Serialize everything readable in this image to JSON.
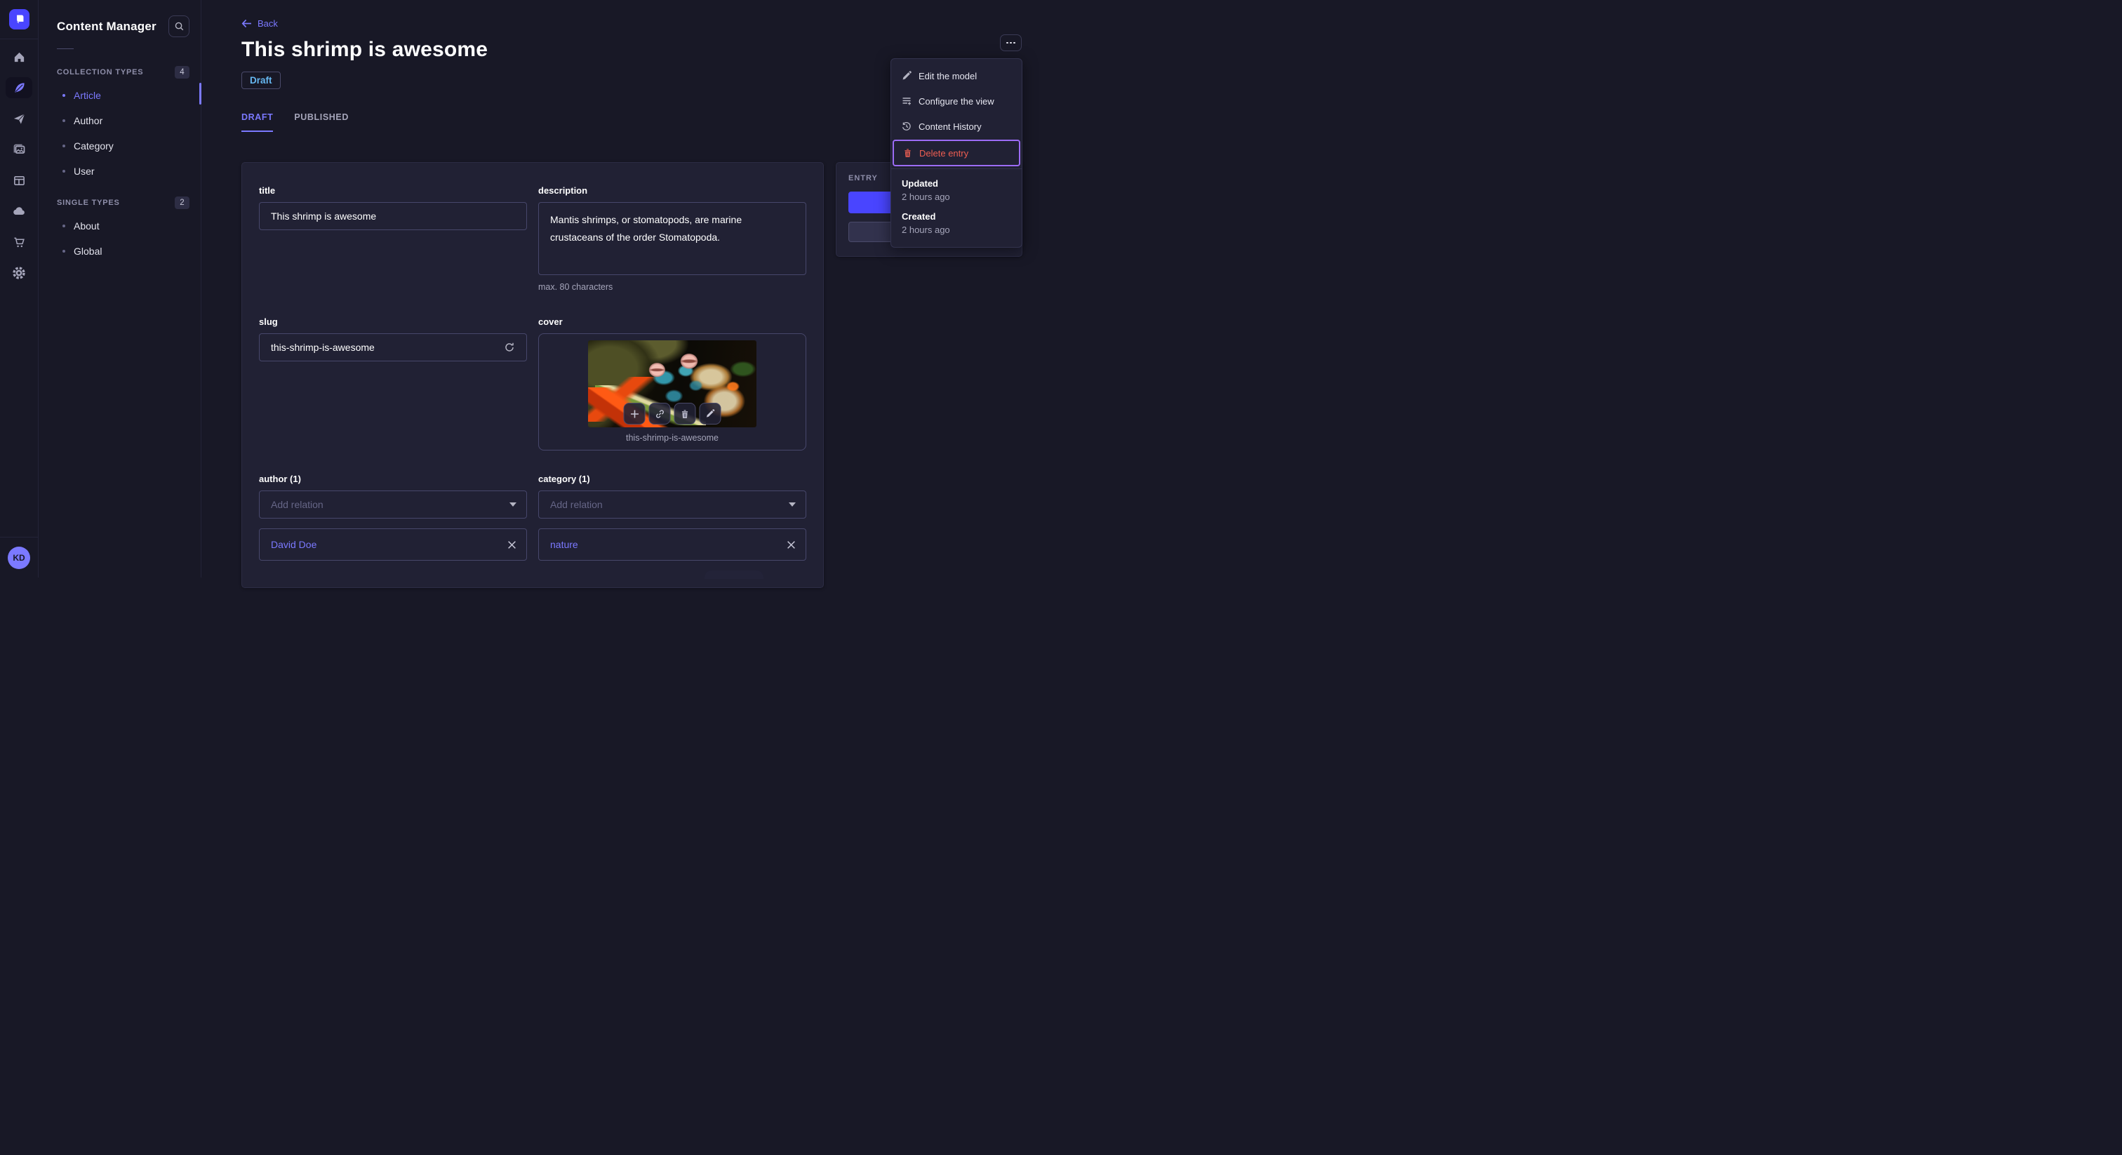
{
  "colors": {
    "accent": "#4945ff",
    "link": "#7b79ff",
    "danger": "#ee5e52",
    "draft_text": "#66b7f1",
    "menu_highlight": "#9c6cf5"
  },
  "icon_sidebar": {
    "logo_icon": "strapi-logo",
    "items": [
      {
        "icon": "home-icon",
        "active": false
      },
      {
        "icon": "feather-icon",
        "active": true
      },
      {
        "icon": "paper-plane-icon",
        "active": false
      },
      {
        "icon": "media-gallery-icon",
        "active": false
      },
      {
        "icon": "layout-icon",
        "active": false
      },
      {
        "icon": "cloud-icon",
        "active": false
      },
      {
        "icon": "cart-icon",
        "active": false
      },
      {
        "icon": "gear-icon",
        "active": false
      }
    ],
    "avatar_initials": "KD"
  },
  "subnav": {
    "title": "Content Manager",
    "sections": [
      {
        "label": "COLLECTION TYPES",
        "count": "4",
        "items": [
          {
            "label": "Article"
          },
          {
            "label": "Author"
          },
          {
            "label": "Category"
          },
          {
            "label": "User"
          }
        ]
      },
      {
        "label": "SINGLE TYPES",
        "count": "2",
        "items": [
          {
            "label": "About"
          },
          {
            "label": "Global"
          }
        ]
      }
    ]
  },
  "header": {
    "back_label": "Back",
    "title": "This shrimp is awesome",
    "status_badge": "Draft",
    "tabs": [
      {
        "label": "DRAFT"
      },
      {
        "label": "PUBLISHED"
      }
    ]
  },
  "more_menu": {
    "items": [
      {
        "label": "Edit the model",
        "icon": "pencil-icon"
      },
      {
        "label": "Configure the view",
        "icon": "list-plus-icon"
      },
      {
        "label": "Content History",
        "icon": "history-icon"
      },
      {
        "label": "Delete entry",
        "icon": "trash-icon"
      }
    ],
    "meta": [
      {
        "label": "Updated",
        "value": "2 hours ago"
      },
      {
        "label": "Created",
        "value": "2 hours ago"
      }
    ]
  },
  "form": {
    "title": {
      "label": "title",
      "value": "This shrimp is awesome"
    },
    "description": {
      "label": "description",
      "value": "Mantis shrimps, or stomatopods, are marine crustaceans of the order Stomatopoda.",
      "hint": "max. 80 characters"
    },
    "slug": {
      "label": "slug",
      "value": "this-shrimp-is-awesome"
    },
    "cover": {
      "label": "cover",
      "caption": "this-shrimp-is-awesome",
      "actions": [
        {
          "icon": "plus-icon"
        },
        {
          "icon": "link-icon"
        },
        {
          "icon": "trash-icon"
        },
        {
          "icon": "pencil-icon"
        }
      ]
    },
    "author": {
      "label": "author (1)",
      "placeholder": "Add relation",
      "relations": [
        {
          "label": "David Doe"
        }
      ]
    },
    "category": {
      "label": "category (1)",
      "placeholder": "Add relation",
      "relations": [
        {
          "label": "nature"
        }
      ]
    }
  },
  "entry_panel": {
    "title": "ENTRY"
  }
}
